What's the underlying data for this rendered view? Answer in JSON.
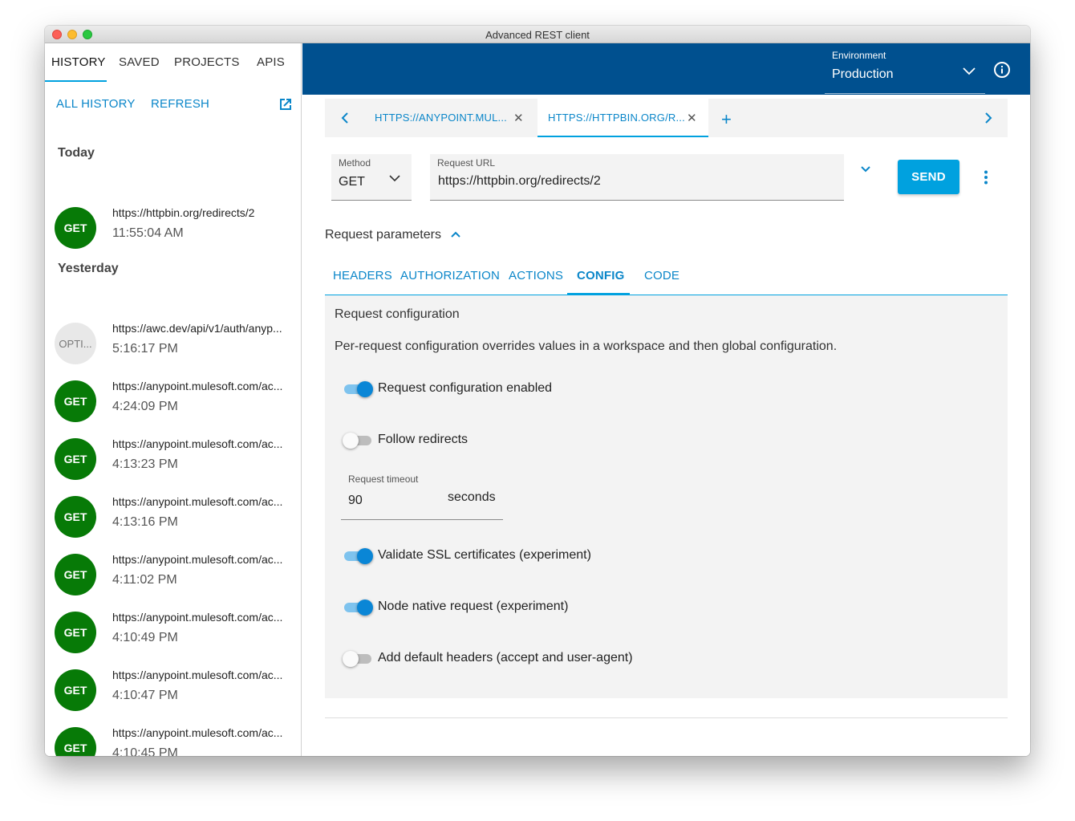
{
  "window": {
    "title": "Advanced REST client"
  },
  "sidebar": {
    "tabs": [
      "HISTORY",
      "SAVED",
      "PROJECTS",
      "APIS"
    ],
    "actions": {
      "all_history": "ALL HISTORY",
      "refresh": "REFRESH"
    },
    "groups": [
      {
        "label": "Today",
        "items": [
          {
            "method": "GET",
            "url": "https://httpbin.org/redirects/2",
            "time": "11:55:04 AM"
          }
        ]
      },
      {
        "label": "Yesterday",
        "items": [
          {
            "method": "OPTI...",
            "url": "https://awc.dev/api/v1/auth/anyp...",
            "time": "5:16:17 PM"
          },
          {
            "method": "GET",
            "url": "https://anypoint.mulesoft.com/ac...",
            "time": "4:24:09 PM"
          },
          {
            "method": "GET",
            "url": "https://anypoint.mulesoft.com/ac...",
            "time": "4:13:23 PM"
          },
          {
            "method": "GET",
            "url": "https://anypoint.mulesoft.com/ac...",
            "time": "4:13:16 PM"
          },
          {
            "method": "GET",
            "url": "https://anypoint.mulesoft.com/ac...",
            "time": "4:11:02 PM"
          },
          {
            "method": "GET",
            "url": "https://anypoint.mulesoft.com/ac...",
            "time": "4:10:49 PM"
          },
          {
            "method": "GET",
            "url": "https://anypoint.mulesoft.com/ac...",
            "time": "4:10:47 PM"
          },
          {
            "method": "GET",
            "url": "https://anypoint.mulesoft.com/ac...",
            "time": "4:10:45 PM"
          }
        ]
      }
    ]
  },
  "header": {
    "environment_label": "Environment",
    "environment_value": "Production"
  },
  "request_tabs": [
    {
      "label": "HTTPS://ANYPOINT.MUL...",
      "active": false
    },
    {
      "label": "HTTPS://HTTPBIN.ORG/R...",
      "active": true
    }
  ],
  "request": {
    "method_label": "Method",
    "method": "GET",
    "url_label": "Request URL",
    "url": "https://httpbin.org/redirects/2",
    "send_label": "SEND"
  },
  "params": {
    "title": "Request parameters",
    "tabs": [
      "HEADERS",
      "AUTHORIZATION",
      "ACTIONS",
      "CONFIG",
      "CODE"
    ],
    "active_tab": "CONFIG"
  },
  "config": {
    "title": "Request configuration",
    "description": "Per-request configuration overrides values in a workspace and then global configuration.",
    "toggles": [
      {
        "label": "Request configuration enabled",
        "on": true
      },
      {
        "label": "Follow redirects",
        "on": false
      },
      {
        "label": "Validate SSL certificates (experiment)",
        "on": true
      },
      {
        "label": "Node native request (experiment)",
        "on": true
      },
      {
        "label": "Add default headers (accept and user-agent)",
        "on": false
      }
    ],
    "timeout": {
      "label": "Request timeout",
      "value": "90",
      "suffix": "seconds"
    }
  },
  "colors": {
    "accent": "#00a1df",
    "header": "#00508f",
    "get_badge": "#077a07"
  },
  "icons": [
    "open-in-new-icon",
    "chevron-down-icon",
    "info-icon",
    "chevron-left-icon",
    "chevron-right-icon",
    "close-icon",
    "add-icon",
    "more-vert-icon",
    "chevron-up-icon"
  ]
}
